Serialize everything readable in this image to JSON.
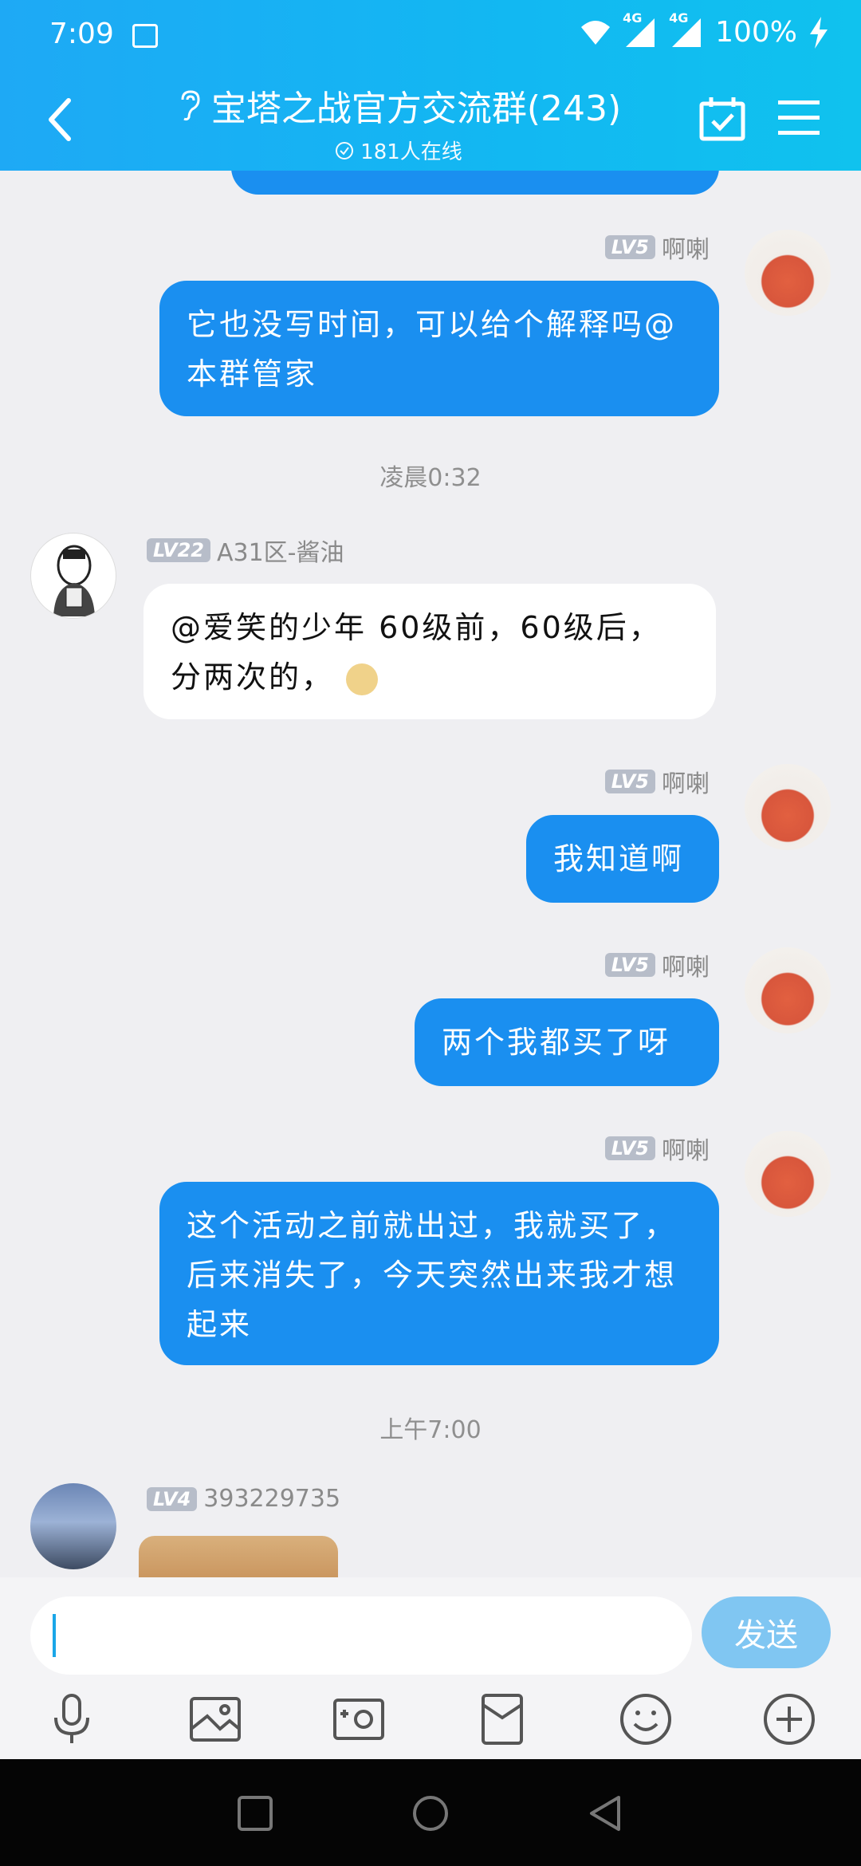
{
  "status_bar": {
    "time": "7:09",
    "network1": "4G",
    "network2": "4G",
    "battery": "100%"
  },
  "header": {
    "title": "宝塔之战官方交流群(243)",
    "online": "181人在线"
  },
  "messages": [
    {
      "side": "me",
      "level": "LV5",
      "name": "啊喇",
      "text": "它也没写时间，可以给个解释吗@本群管家"
    },
    {
      "type": "time",
      "text": "凌晨0:32"
    },
    {
      "side": "them",
      "level": "LV22",
      "name": "A31区-酱油",
      "text": "@爱笑的少年 60级前，60级后，分两次的，"
    },
    {
      "side": "me",
      "level": "LV5",
      "name": "啊喇",
      "text": "我知道啊"
    },
    {
      "side": "me",
      "level": "LV5",
      "name": "啊喇",
      "text": "两个我都买了呀"
    },
    {
      "side": "me",
      "level": "LV5",
      "name": "啊喇",
      "text": "这个活动之前就出过，我就买了，后来消失了，今天突然出来我才想起来"
    },
    {
      "type": "time",
      "text": "上午7:00"
    },
    {
      "side": "them",
      "level": "LV4",
      "name": "393229735",
      "text": ""
    }
  ],
  "composer": {
    "send_label": "发送",
    "placeholder": ""
  },
  "colors": {
    "header": "#1ea9f5",
    "my_bubble": "#1a8ff0",
    "send_button": "#80c6f2"
  }
}
